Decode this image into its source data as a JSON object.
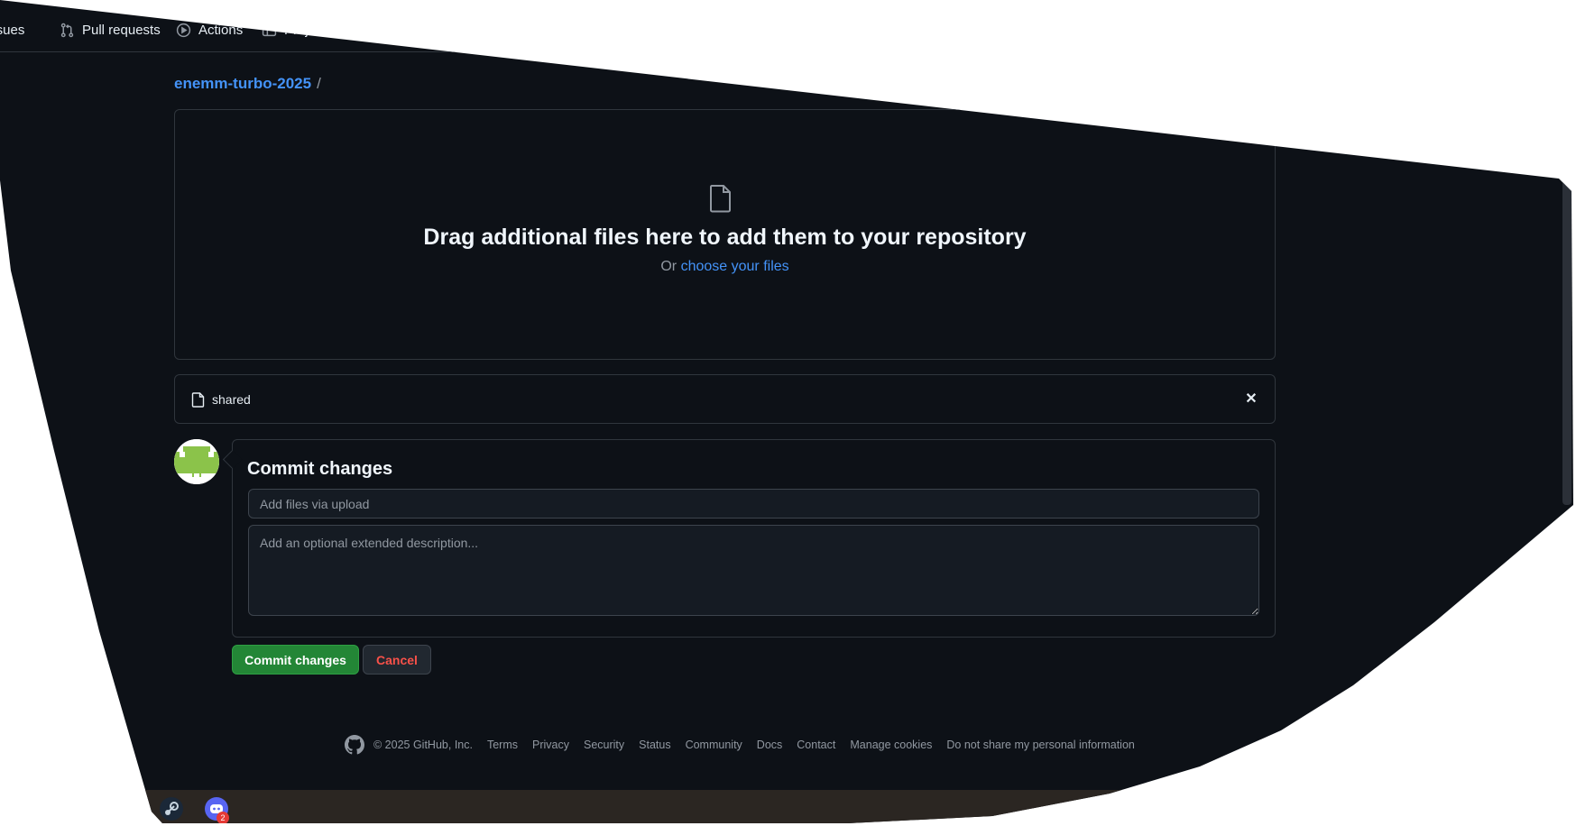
{
  "nav": {
    "issues_label": "Issues",
    "pull_requests_label": "Pull requests",
    "actions_label": "Actions",
    "projects_label": "Projects"
  },
  "breadcrumb": {
    "repo": "enemm-turbo-2025",
    "separator": "/"
  },
  "dropzone": {
    "title": "Drag additional files here to add them to your repository",
    "prefix": "Or",
    "choose_link": "choose your files"
  },
  "file": {
    "name": "shared",
    "remove_label": "✕"
  },
  "commit": {
    "title": "Commit changes",
    "summary_placeholder": "Add files via upload",
    "description_placeholder": "Add an optional extended description...",
    "commit_button": "Commit changes",
    "cancel_button": "Cancel"
  },
  "footer": {
    "copyright": "© 2025 GitHub, Inc.",
    "links": [
      "Terms",
      "Privacy",
      "Security",
      "Status",
      "Community",
      "Docs",
      "Contact",
      "Manage cookies",
      "Do not share my personal information"
    ]
  },
  "taskbar": {
    "discord_badge": "2"
  },
  "colors": {
    "background": "#0d1117",
    "link": "#4493f8",
    "commit_green": "#238636",
    "cancel_red": "#f85149",
    "border": "#30363d"
  }
}
